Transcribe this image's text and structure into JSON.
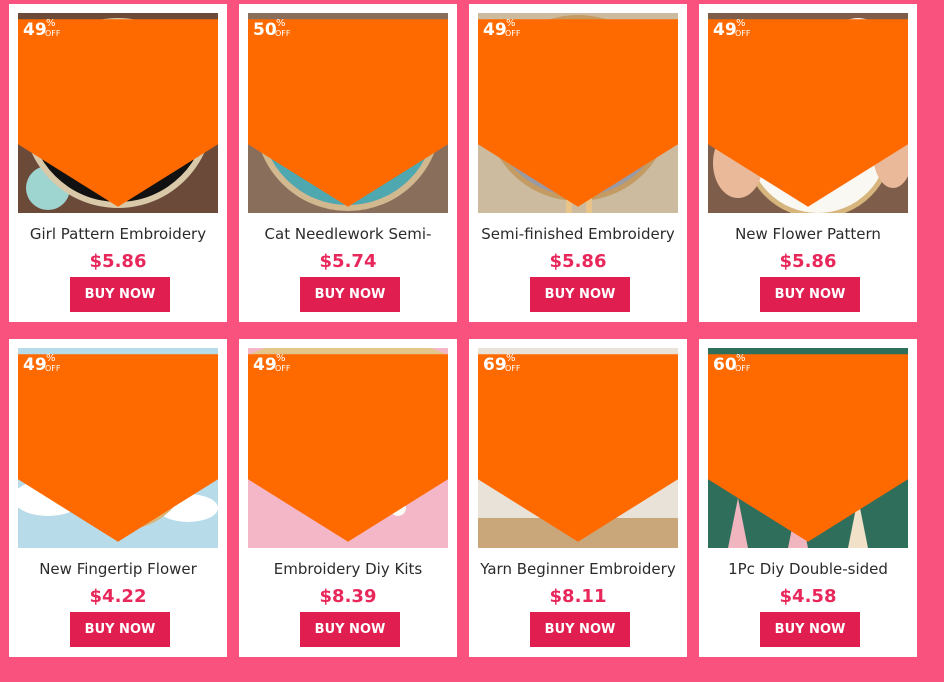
{
  "buy_label": "BUY NOW",
  "pct_symbol": "%",
  "off_label": "OFF",
  "colors": {
    "background": "#f9527f",
    "buy_button": "#e01e50",
    "price": "#e8275b",
    "badge": "#ff6a00"
  },
  "products": [
    {
      "discount": "49",
      "title": "Girl Pattern Embroidery",
      "price": "$5.86"
    },
    {
      "discount": "50",
      "title": "Cat Needlework Semi-",
      "price": "$5.74"
    },
    {
      "discount": "49",
      "title": "Semi-finished Embroidery",
      "price": "$5.86"
    },
    {
      "discount": "49",
      "title": "New Flower Pattern",
      "price": "$5.86"
    },
    {
      "discount": "49",
      "title": "New Fingertip Flower",
      "price": "$4.22"
    },
    {
      "discount": "49",
      "title": "Embroidery Diy Kits",
      "price": "$8.39"
    },
    {
      "discount": "69",
      "title": "Yarn Beginner Embroidery",
      "price": "$8.11"
    },
    {
      "discount": "60",
      "title": "1Pc Diy Double-sided",
      "price": "$4.58"
    }
  ]
}
